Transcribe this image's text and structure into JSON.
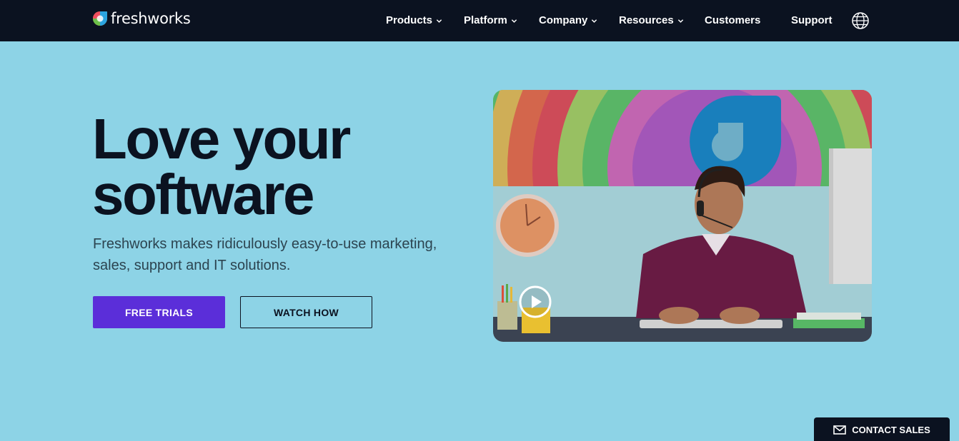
{
  "brand": {
    "name": "freshworks"
  },
  "nav": {
    "items": [
      {
        "label": "Products",
        "has_menu": true
      },
      {
        "label": "Platform",
        "has_menu": true
      },
      {
        "label": "Company",
        "has_menu": true
      },
      {
        "label": "Resources",
        "has_menu": true
      },
      {
        "label": "Customers",
        "has_menu": false
      },
      {
        "label": "Support",
        "has_menu": false
      }
    ],
    "language_icon": "globe-icon"
  },
  "hero": {
    "title_line1": "Love your",
    "title_line2": "software",
    "subtitle": "Freshworks makes ridiculously easy-to-use marketing, sales, support and IT solutions.",
    "primary_cta": "FREE TRIALS",
    "secondary_cta": "WATCH HOW",
    "video_icon": "play-icon"
  },
  "contact": {
    "label": "CONTACT SALES",
    "icon": "mail-icon"
  },
  "colors": {
    "nav_bg": "#0b1220",
    "page_bg": "#8dd3e6",
    "primary": "#5b2ed9",
    "text_dark": "#0b1220"
  }
}
